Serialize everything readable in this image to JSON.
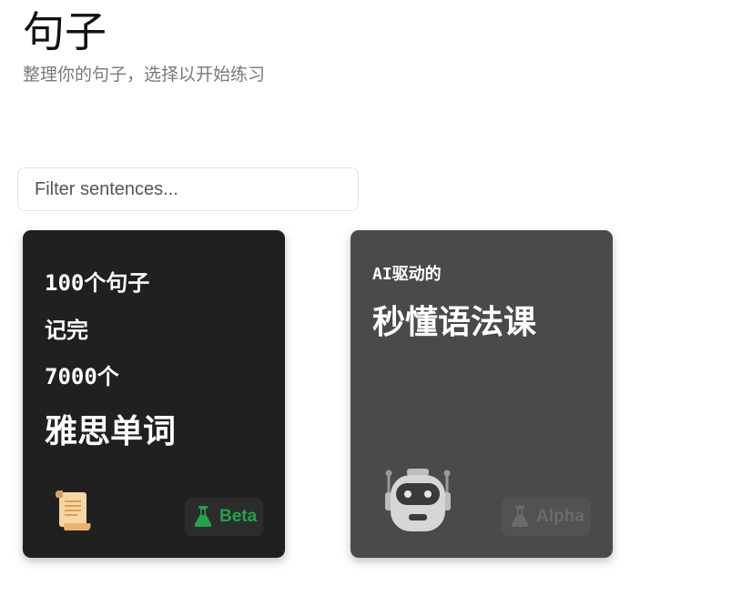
{
  "header": {
    "title": "句子",
    "subtitle": "整理你的句子，选择以开始练习"
  },
  "filter": {
    "placeholder": "Filter sentences...",
    "value": ""
  },
  "cards": [
    {
      "lines": [
        "100个句子",
        "记完",
        "7000个",
        "雅思单词"
      ],
      "icon": "scroll-icon",
      "badge": "Beta",
      "badge_color": "#22a34a",
      "background": "#202020"
    },
    {
      "subtitle": "AI驱动的",
      "title": "秒懂语法课",
      "icon": "robot-icon",
      "badge": "Alpha",
      "badge_color": "#6b6b6b",
      "background": "#4a4a4a"
    }
  ]
}
